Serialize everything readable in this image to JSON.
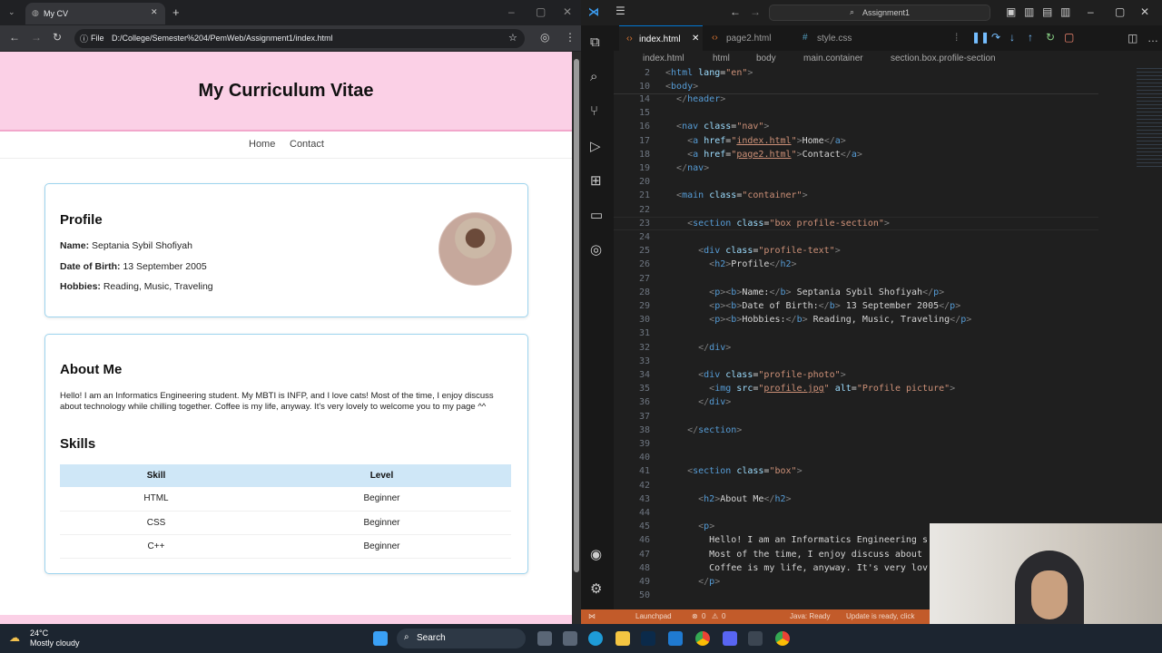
{
  "browser": {
    "tab_title": "My CV",
    "address_prefix": "File",
    "address": "D:/College/Semester%204/PemWeb/Assignment1/index.html"
  },
  "cv": {
    "header_title": "My Curriculum Vitae",
    "nav": [
      "Home",
      "Contact"
    ],
    "profile": {
      "heading": "Profile",
      "name_label": "Name:",
      "name": "Septania Sybil Shofiyah",
      "dob_label": "Date of Birth:",
      "dob": "13 September 2005",
      "hobbies_label": "Hobbies:",
      "hobbies": "Reading, Music, Traveling"
    },
    "about": {
      "heading": "About Me",
      "text": "Hello! I am an Informatics Engineering student. My MBTI is INFP, and I love cats! Most of the time, I enjoy discuss about technology while chilling together. Coffee is my life, anyway. It's very lovely to welcome you to my page ^^"
    },
    "skills": {
      "heading": "Skills",
      "columns": [
        "Skill",
        "Level"
      ],
      "rows": [
        [
          "HTML",
          "Beginner"
        ],
        [
          "CSS",
          "Beginner"
        ],
        [
          "C++",
          "Beginner"
        ]
      ]
    }
  },
  "vscode": {
    "search_text": "Assignment1",
    "tabs": [
      {
        "label": "index.html",
        "active": true
      },
      {
        "label": "page2.html",
        "active": false
      },
      {
        "label": "style.css",
        "active": false
      }
    ],
    "breadcrumbs": [
      "index.html",
      "html",
      "body",
      "main.container",
      "section.box.profile-section"
    ],
    "status": {
      "launchpad": "Launchpad",
      "errors": "0",
      "warnings": "0",
      "java": "Java: Ready",
      "update": "Update is ready, click"
    }
  },
  "taskbar": {
    "temp": "24°C",
    "weather": "Mostly cloudy",
    "search": "Search"
  }
}
